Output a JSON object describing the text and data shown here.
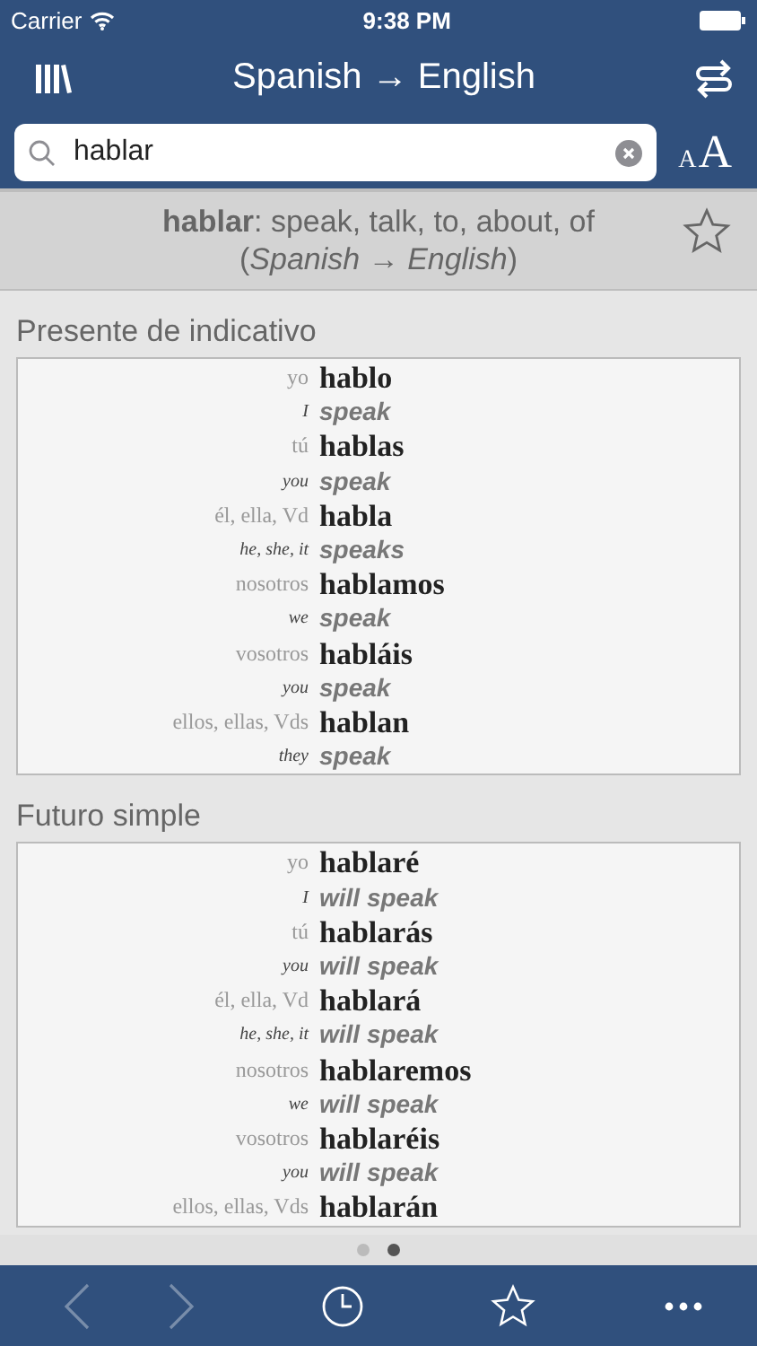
{
  "status_bar": {
    "carrier": "Carrier",
    "time": "9:38 PM"
  },
  "nav": {
    "title": "Spanish → English"
  },
  "search": {
    "value": "hablar",
    "font_size_label_small": "A",
    "font_size_label_large": "A"
  },
  "entry": {
    "definition": "**hablar**: speak, talk, to, about, of",
    "direction": "(*Spanish* → *English*)",
    "starred": false
  },
  "sections": [
    {
      "title": "Presente de indicativo",
      "rows": [
        {
          "kind": "es",
          "pronoun": "yo",
          "form": "hablo"
        },
        {
          "kind": "en",
          "pronoun": "I",
          "form": "speak"
        },
        {
          "kind": "es",
          "pronoun": "tú",
          "form": "hablas"
        },
        {
          "kind": "en",
          "pronoun": "you",
          "form": "speak"
        },
        {
          "kind": "es",
          "pronoun": "él, ella, Vd",
          "form": "habla"
        },
        {
          "kind": "en",
          "pronoun": "he, she, it",
          "form": "speaks"
        },
        {
          "kind": "es",
          "pronoun": "nosotros",
          "form": "hablamos"
        },
        {
          "kind": "en",
          "pronoun": "we",
          "form": "speak"
        },
        {
          "kind": "es",
          "pronoun": "vosotros",
          "form": "habláis"
        },
        {
          "kind": "en",
          "pronoun": "you",
          "form": "speak"
        },
        {
          "kind": "es",
          "pronoun": "ellos, ellas, Vds",
          "form": "hablan"
        },
        {
          "kind": "en",
          "pronoun": "they",
          "form": "speak"
        }
      ]
    },
    {
      "title": "Futuro simple",
      "rows": [
        {
          "kind": "es",
          "pronoun": "yo",
          "form": "hablaré"
        },
        {
          "kind": "en",
          "pronoun": "I",
          "form": "will speak"
        },
        {
          "kind": "es",
          "pronoun": "tú",
          "form": "hablarás"
        },
        {
          "kind": "en",
          "pronoun": "you",
          "form": "will speak"
        },
        {
          "kind": "es",
          "pronoun": "él, ella, Vd",
          "form": "hablará"
        },
        {
          "kind": "en",
          "pronoun": "he, she, it",
          "form": "will speak"
        },
        {
          "kind": "es",
          "pronoun": "nosotros",
          "form": "hablaremos"
        },
        {
          "kind": "en",
          "pronoun": "we",
          "form": "will speak"
        },
        {
          "kind": "es",
          "pronoun": "vosotros",
          "form": "hablaréis"
        },
        {
          "kind": "en",
          "pronoun": "you",
          "form": "will speak"
        },
        {
          "kind": "es",
          "pronoun": "ellos, ellas, Vds",
          "form": "hablarán"
        }
      ]
    }
  ],
  "pager": [
    {
      "selected": false
    },
    {
      "selected": true
    }
  ],
  "toolbar": {
    "back_disabled": true,
    "forward_disabled": true
  }
}
